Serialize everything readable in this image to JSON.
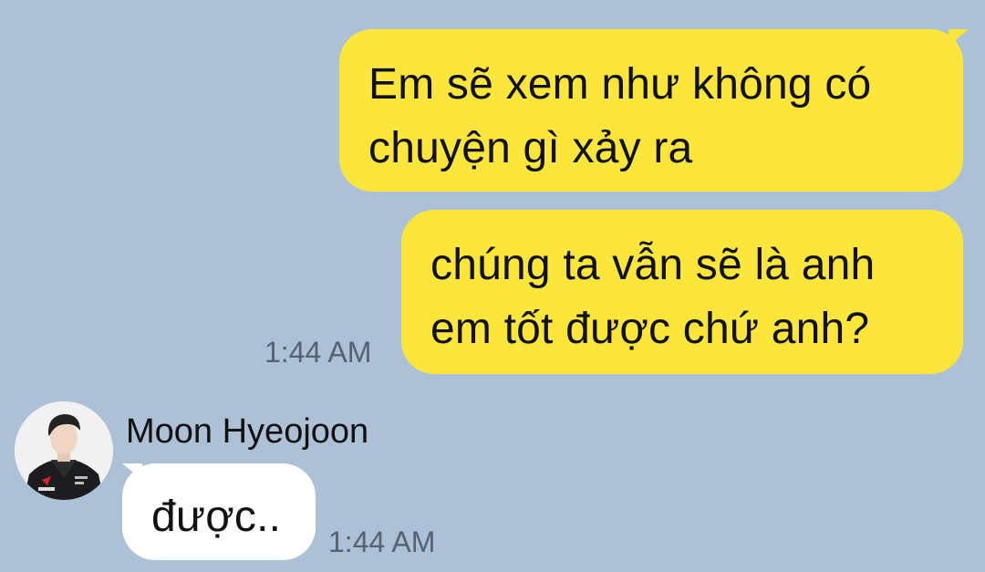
{
  "conversation": {
    "messages": [
      {
        "direction": "outgoing",
        "lines": [
          "Em sẽ xem như không có",
          "chuyện gì xảy ra"
        ]
      },
      {
        "direction": "outgoing",
        "lines": [
          "chúng ta vẫn sẽ là anh",
          "em tốt được chứ anh?"
        ],
        "time": "1:44 AM"
      },
      {
        "direction": "incoming",
        "sender": "Moon Hyeojoon",
        "lines": [
          "được.."
        ],
        "time": "1:44 AM",
        "avatar_icon": "profile-photo"
      }
    ]
  },
  "colors": {
    "background": "#acc1d6",
    "outgoing_bubble": "#fde63c",
    "incoming_bubble": "#ffffff",
    "timestamp": "#556273"
  }
}
